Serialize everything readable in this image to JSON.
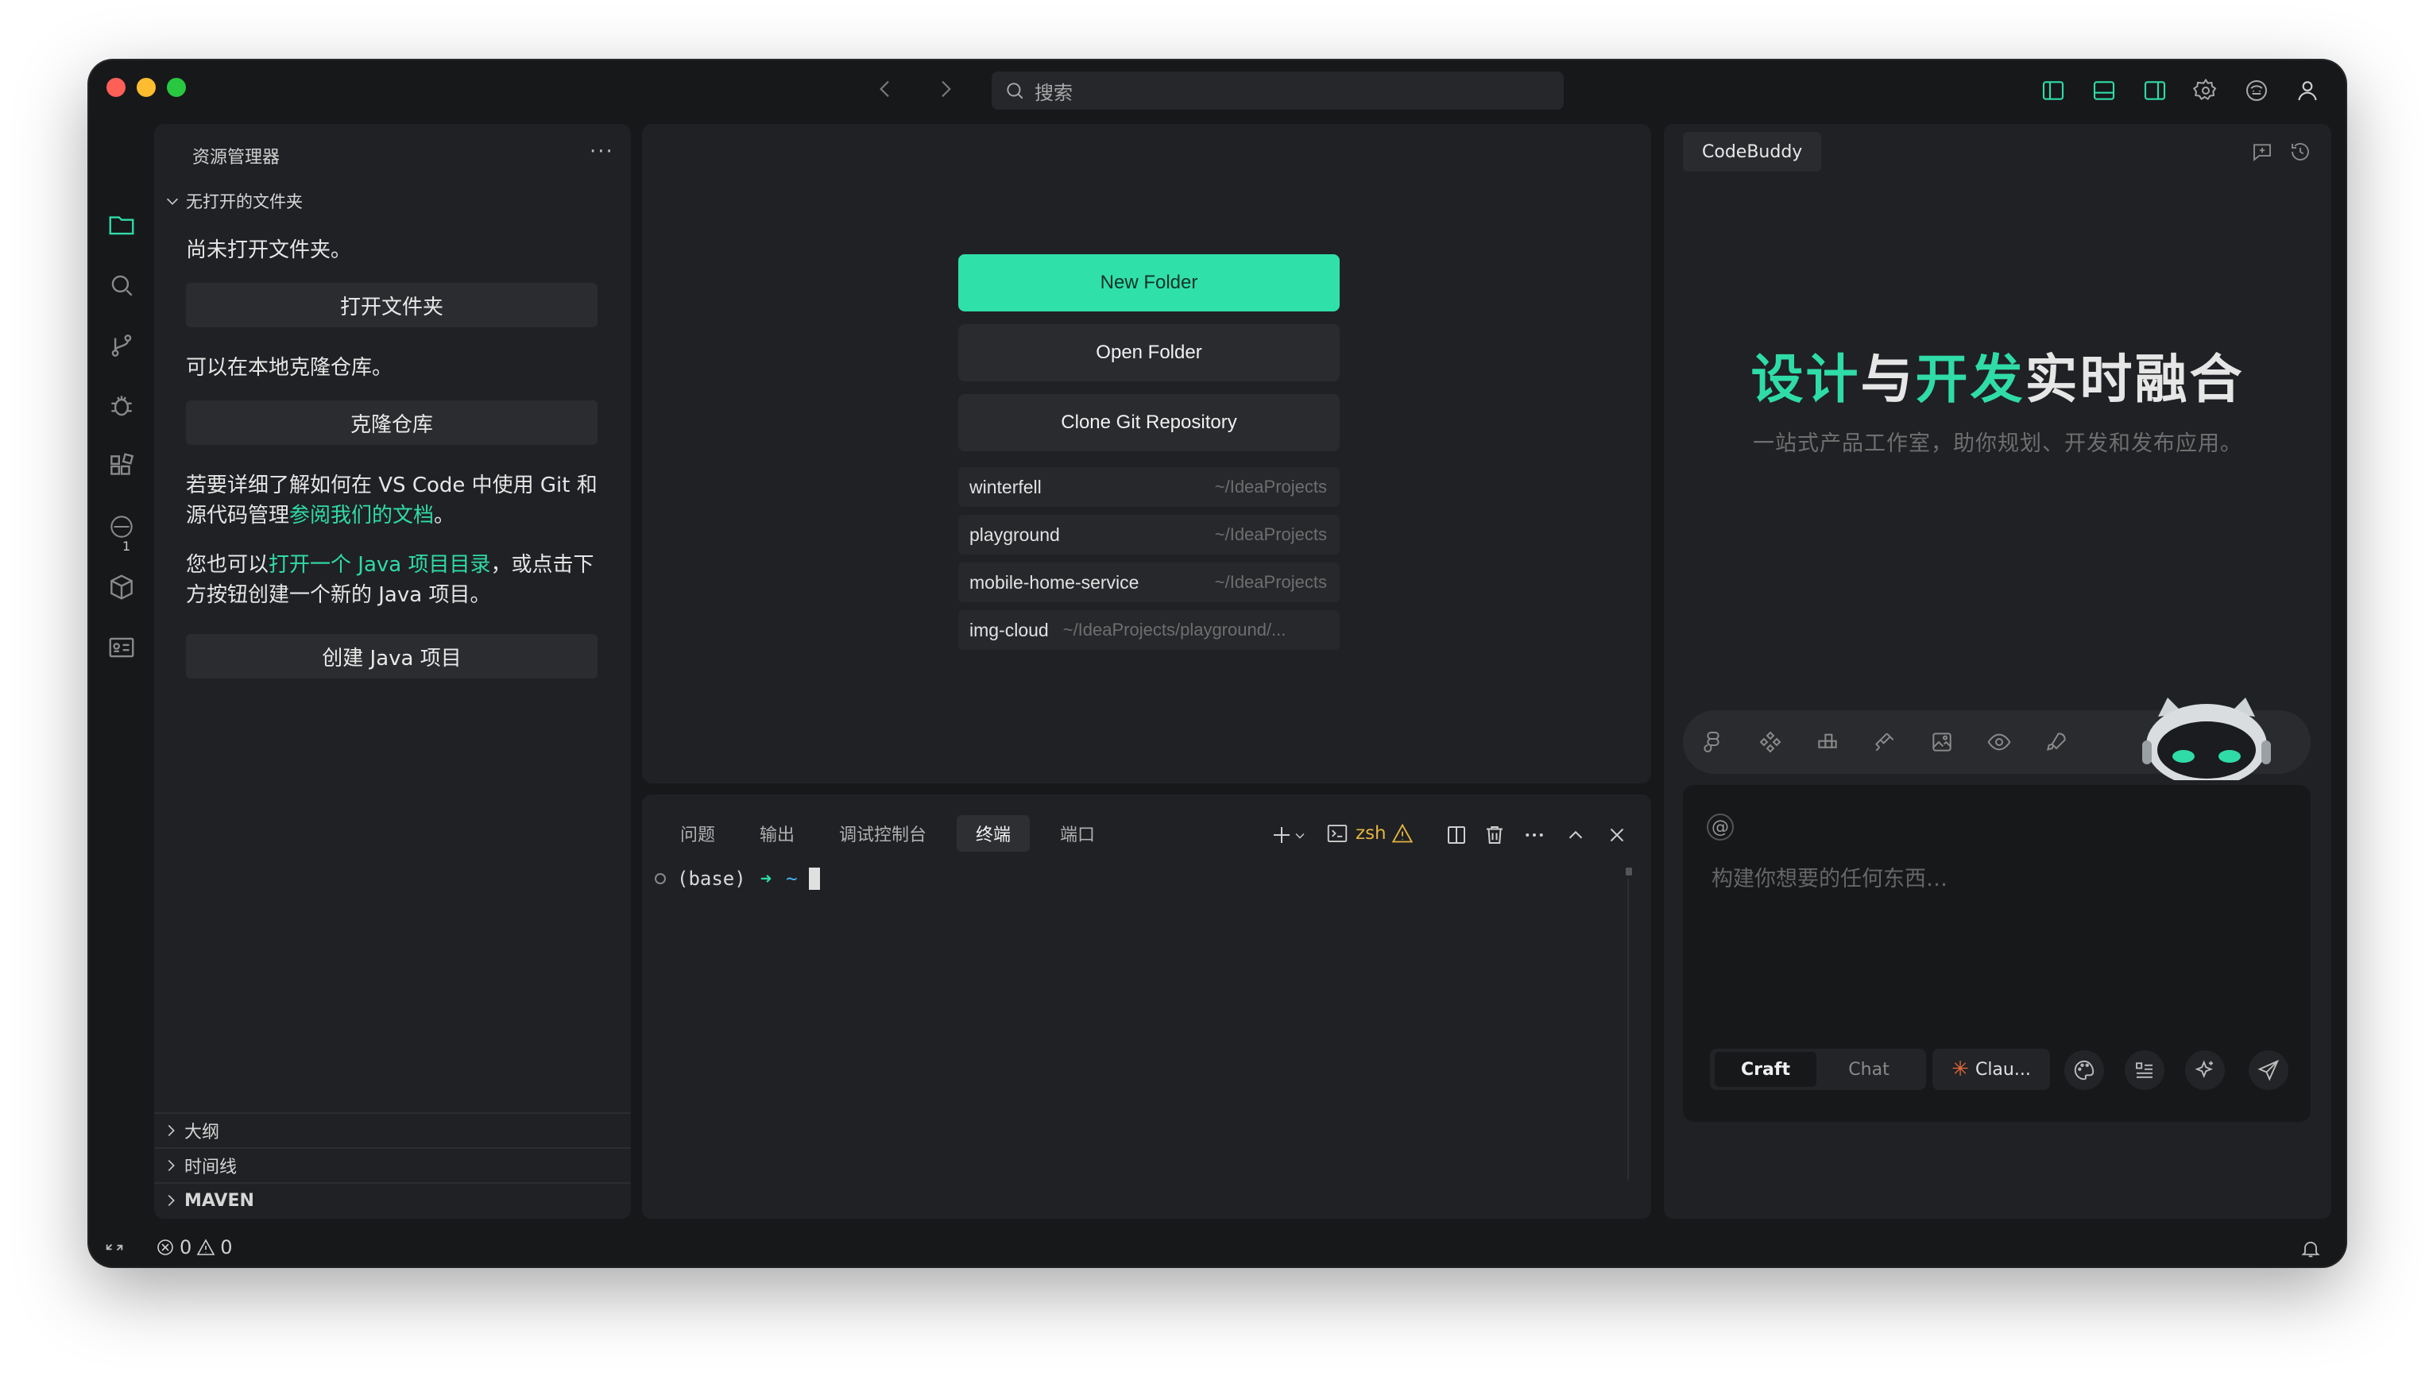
{
  "titlebar": {
    "search_placeholder": "搜索"
  },
  "sidebar": {
    "title": "资源管理器",
    "more": "···",
    "section": "无打开的文件夹",
    "no_folder_text": "尚未打开文件夹。",
    "open_folder_btn": "打开文件夹",
    "clone_text": "可以在本地克隆仓库。",
    "clone_btn": "克隆仓库",
    "git_text_prefix": "若要详细了解如何在 VS Code 中使用 Git 和源代码管理",
    "git_link": "参阅我们的文档",
    "git_text_suffix": "。",
    "java_text_prefix": "您也可以",
    "java_link": "打开一个 Java 项目目录",
    "java_text_suffix": "，或点击下方按钮创建一个新的 Java 项目。",
    "java_btn": "创建 Java 项目",
    "bottom_sections": [
      "大纲",
      "时间线",
      "MAVEN"
    ],
    "scm_badge": "1"
  },
  "editor": {
    "new_folder": "New Folder",
    "open_folder": "Open Folder",
    "clone_repo": "Clone Git Repository",
    "recent": [
      {
        "name": "winterfell",
        "path": "~/IdeaProjects"
      },
      {
        "name": "playground",
        "path": "~/IdeaProjects"
      },
      {
        "name": "mobile-home-service",
        "path": "~/IdeaProjects"
      },
      {
        "name": "img-cloud",
        "path": "~/IdeaProjects/playground/..."
      }
    ]
  },
  "panel": {
    "tabs": [
      "问题",
      "输出",
      "调试控制台",
      "终端",
      "端口"
    ],
    "active_tab": "终端",
    "shell": "zsh",
    "prompt_env": "(base)",
    "prompt_arrow": "➜",
    "prompt_dir": "~"
  },
  "chat": {
    "tab": "CodeBuddy",
    "hero_g1": "设计",
    "hero_w1": "与",
    "hero_g2": "开发",
    "hero_w2": "实时融合",
    "subtitle": "一站式产品工作室，助你规划、开发和发布应用。",
    "placeholder": "构建你想要的任何东西…",
    "at": "@",
    "mode_on": "Craft",
    "mode_off": "Chat",
    "model": "Clau..."
  },
  "status": {
    "errors": "0",
    "warnings": "0"
  },
  "colors": {
    "accent": "#30e0a9",
    "window_bg": "#17181a",
    "panel_bg": "#202124"
  }
}
